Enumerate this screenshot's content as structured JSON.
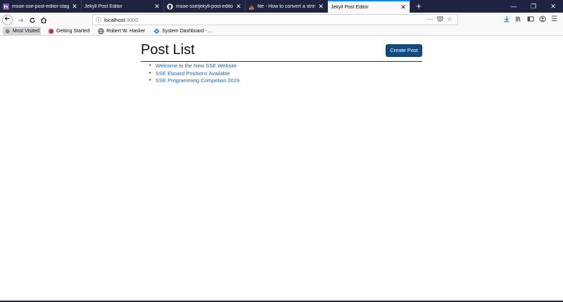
{
  "tabs": [
    {
      "title": "msoe-sse-post-editor-staging",
      "selected": false
    },
    {
      "title": "Jekyll Post Editor",
      "selected": false
    },
    {
      "title": "msoe-sse/jekyll-post-editor at",
      "selected": false
    },
    {
      "title": "file - How to convert a string to",
      "selected": false
    },
    {
      "title": "Jekyll Post Editor",
      "selected": true
    }
  ],
  "new_tab_symbol": "+",
  "window_controls": [
    "—",
    "❐",
    "✕"
  ],
  "url": {
    "host": "localhost",
    "port": ":3000"
  },
  "bookmarks": [
    {
      "label": "Most Visited"
    },
    {
      "label": "Getting Started"
    },
    {
      "label": "Robert W. Hasker"
    },
    {
      "label": "System Dashboard - ..."
    }
  ],
  "page": {
    "title": "Post List",
    "create_button": "Create Post",
    "posts": [
      "Welcome to the New SSE Website",
      "SSE Eboard Positions Available",
      "SSE Programming Competion 2019"
    ]
  },
  "colors": {
    "tabstrip": "#202340",
    "accent": "#0a84ff",
    "button": "#0f4c81",
    "link": "#1a63b5"
  }
}
